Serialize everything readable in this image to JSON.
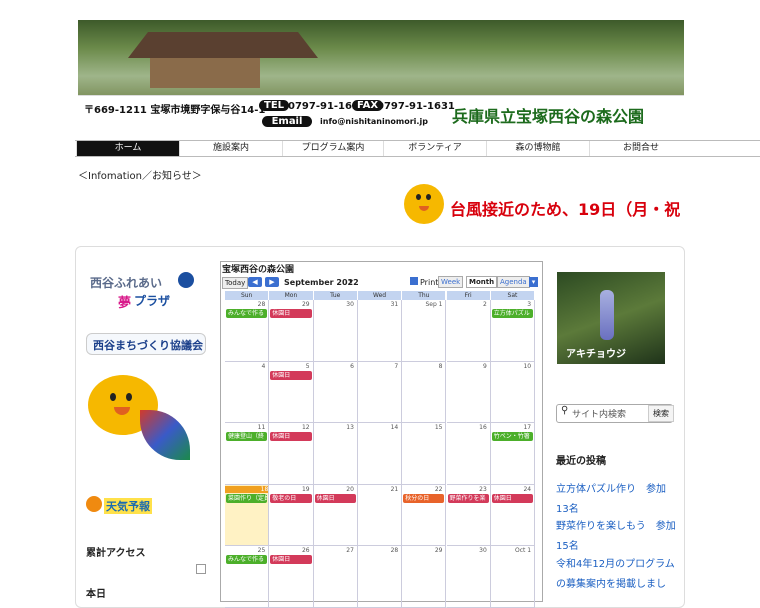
{
  "header": {
    "address": "〒669-1211 宝塚市境野字保与谷14-1",
    "tel_label": "TEL",
    "tel": "0797-91-1630",
    "fax_label": "FAX",
    "fax": "0797-91-1631",
    "email_label": "Email",
    "email": "info@nishitaninomori.jp",
    "park_name": "兵庫県立宝塚西谷の森公園"
  },
  "nav": {
    "items": [
      "ホーム",
      "施設案内",
      "プログラム案内",
      "ボランティア",
      "森の博物館",
      "お問合せ"
    ],
    "active": "ホーム"
  },
  "info": {
    "heading": "＜Infomation／お知らせ＞",
    "ticker": "台風接近のため、19日（月・祝"
  },
  "left": {
    "plaza_line1": "西谷ふれあい",
    "plaza_line2_a": "夢",
    "plaza_line2_b": "プラザ",
    "council": "西谷まちづくり協議会",
    "weather": "天気予報",
    "access_label": "累計アクセス",
    "today_label": "本日"
  },
  "calendar": {
    "title": "宝塚西谷の森公園",
    "today_btn": "Today",
    "prev": "◀",
    "next": "▶",
    "month": "September 2022",
    "print": "Print",
    "views": [
      "Week",
      "Month",
      "Agenda"
    ],
    "active_view": "Month",
    "days": [
      "Sun",
      "Mon",
      "Tue",
      "Wed",
      "Thu",
      "Fri",
      "Sat"
    ],
    "weeks": [
      [
        "28",
        "29",
        "30",
        "31",
        "Sep 1",
        "2",
        "3"
      ],
      [
        "4",
        "5",
        "6",
        "7",
        "8",
        "9",
        "10"
      ],
      [
        "11",
        "12",
        "13",
        "14",
        "15",
        "16",
        "17"
      ],
      [
        "18",
        "19",
        "20",
        "21",
        "22",
        "23",
        "24"
      ],
      [
        "25",
        "26",
        "27",
        "28",
        "29",
        "30",
        "Oct 1"
      ]
    ],
    "events": {
      "w0": [
        {
          "day": 0,
          "label": "みんなで作る",
          "color": "g"
        },
        {
          "day": 1,
          "label": "休園日",
          "color": "r"
        },
        {
          "day": 6,
          "label": "立方体パズル",
          "color": "g"
        }
      ],
      "w1": [
        {
          "day": 1,
          "label": "休園日",
          "color": "r"
        }
      ],
      "w2": [
        {
          "day": 0,
          "label": "健康登山（終",
          "color": "g"
        },
        {
          "day": 1,
          "label": "休園日",
          "color": "r"
        },
        {
          "day": 6,
          "label": "竹ペン・竹箸",
          "color": "g"
        }
      ],
      "w3": [
        {
          "day": 0,
          "label": "菜園作り（定員",
          "color": "g"
        },
        {
          "day": 1,
          "label": "敬老の日",
          "color": "r"
        },
        {
          "day": 2,
          "label": "休園日",
          "color": "r"
        },
        {
          "day": 4,
          "label": "秋分の日",
          "color": "o"
        },
        {
          "day": 5,
          "label": "野菜作りを楽",
          "color": "r"
        },
        {
          "day": 6,
          "label": "休園日",
          "color": "r"
        }
      ],
      "w4": [
        {
          "day": 0,
          "label": "みんなで作る",
          "color": "g"
        },
        {
          "day": 1,
          "label": "休園日",
          "color": "r"
        }
      ]
    },
    "today_col": 0,
    "today_week": 3
  },
  "right": {
    "photo_label": "アキチョウジ",
    "search_placeholder": "サイト内検索",
    "search_btn": "検索",
    "recent_heading": "最近の投稿",
    "posts": [
      "立方体パズル作り　参加13名",
      "野菜作りを楽しもう　参加15名",
      "令和4年12月のプログラムの募集案内を掲載しまし"
    ]
  }
}
